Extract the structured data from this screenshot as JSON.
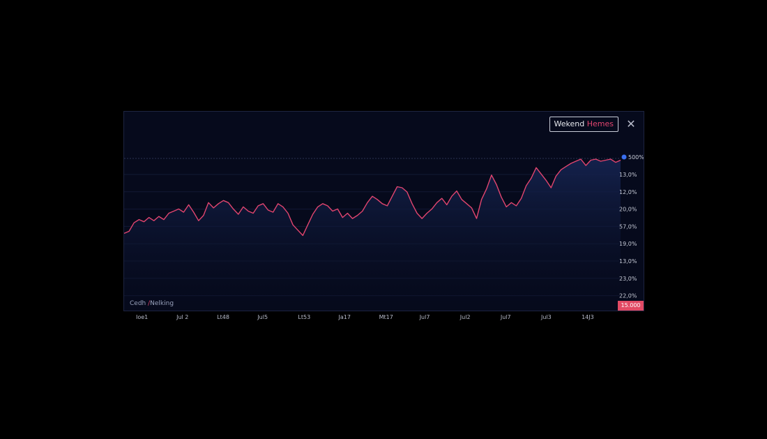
{
  "legend": {
    "prefix": "Wekend ",
    "accent": "Hemes"
  },
  "close_label": "✕",
  "series_label": {
    "prefix": "Cedh ",
    "accent": "/",
    "suffix": "Nelking"
  },
  "last_value": "15.000",
  "top_marker_label": "500%",
  "colors": {
    "background": "#000000",
    "card": "#060a1c",
    "line": "#e2456f",
    "fill_top": "#15234f",
    "marker": "#3a6ff0",
    "last_value_bg": "#e24a64"
  },
  "chart_data": {
    "type": "area",
    "title": "",
    "xlabel": "",
    "ylabel": "",
    "grid": true,
    "y_tick_labels": [
      "13,0%",
      "12,0%",
      "20,0%",
      "57,0%",
      "19,0%",
      "13,0%",
      "23,0%",
      "22,0%"
    ],
    "x_tick_labels": [
      "Ioe1",
      "Jul 2",
      "Lt48",
      "Jul5",
      "Lt53",
      "Ja17",
      "Mt17",
      "Jul7",
      "Jul2",
      "Jul7",
      "Jul3",
      "14J3"
    ],
    "x": [
      0,
      1,
      2,
      3,
      4,
      5,
      6,
      7,
      8,
      9,
      10,
      11,
      12,
      13,
      14,
      15,
      16,
      17,
      18,
      19,
      20,
      21,
      22,
      23,
      24,
      25,
      26,
      27,
      28,
      29,
      30,
      31,
      32,
      33,
      34,
      35,
      36,
      37,
      38,
      39,
      40,
      41,
      42,
      43,
      44,
      45,
      46,
      47,
      48,
      49,
      50,
      51,
      52,
      53,
      54,
      55,
      56,
      57,
      58,
      59,
      60,
      61,
      62,
      63,
      64,
      65,
      66,
      67,
      68,
      69,
      70,
      71,
      72,
      73,
      74,
      75,
      76,
      77,
      78,
      79,
      80,
      81,
      82,
      83,
      84,
      85,
      86,
      87,
      88,
      89,
      90,
      91,
      92,
      93,
      94,
      95,
      96,
      97,
      98,
      99,
      100
    ],
    "ylim": [
      0,
      10
    ],
    "series": [
      {
        "values": [
          3.0,
          3.2,
          4.0,
          4.3,
          4.1,
          4.5,
          4.2,
          4.6,
          4.3,
          4.9,
          5.1,
          5.3,
          5.0,
          5.7,
          5.0,
          4.2,
          4.7,
          5.9,
          5.4,
          5.8,
          6.1,
          5.9,
          5.3,
          4.8,
          5.5,
          5.1,
          4.9,
          5.6,
          5.8,
          5.2,
          5.0,
          5.8,
          5.5,
          4.9,
          3.8,
          3.3,
          2.8,
          3.8,
          4.8,
          5.5,
          5.8,
          5.6,
          5.1,
          5.3,
          4.5,
          4.9,
          4.4,
          4.7,
          5.1,
          5.9,
          6.5,
          6.2,
          5.8,
          5.6,
          6.5,
          7.4,
          7.3,
          6.9,
          5.8,
          4.9,
          4.4,
          4.9,
          5.3,
          5.9,
          6.3,
          5.7,
          6.5,
          7.0,
          6.2,
          5.8,
          5.4,
          4.4,
          6.2,
          7.2,
          8.5,
          7.6,
          6.4,
          5.5,
          5.9,
          5.6,
          6.3,
          7.5,
          8.2,
          9.2,
          8.6,
          8.0,
          7.3,
          8.4,
          9.0,
          9.3,
          9.6,
          9.8,
          10.0,
          9.4,
          9.9,
          10.0,
          9.8,
          9.9,
          10.0,
          9.7,
          9.9
        ]
      }
    ]
  }
}
